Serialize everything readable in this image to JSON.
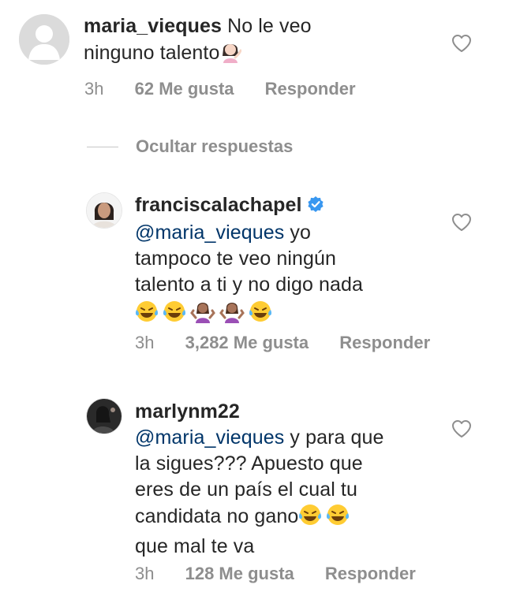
{
  "comments": [
    {
      "username": "maria_vieques",
      "text_line1": " No le veo",
      "text_line2": "ninguno talento",
      "time": "3h",
      "likes": "62 Me gusta",
      "reply_label": "Responder",
      "verified": false
    },
    {
      "username": "franciscalachapel",
      "mention": "@maria_vieques",
      "text_line1": " yo",
      "text_line2": "tampoco te veo ningún",
      "text_line3": "talento a ti y no digo nada",
      "time": "3h",
      "likes": "3,282 Me gusta",
      "reply_label": "Responder",
      "verified": true
    },
    {
      "username": "marlynm22",
      "mention": "@maria_vieques",
      "text_line1": " y para que",
      "text_line2": "la sigues??? Apuesto que",
      "text_line3": "eres de un país el cual tu",
      "text_line4": "candidata no gano",
      "text_line5": "que mal te va",
      "time": "3h",
      "likes": "128 Me gusta",
      "reply_label": "Responder",
      "verified": false
    }
  ],
  "hide_replies_label": "Ocultar respuestas",
  "colors": {
    "text": "#262626",
    "meta": "#8e8e8e",
    "mention": "#003569",
    "verified": "#3897f0"
  }
}
